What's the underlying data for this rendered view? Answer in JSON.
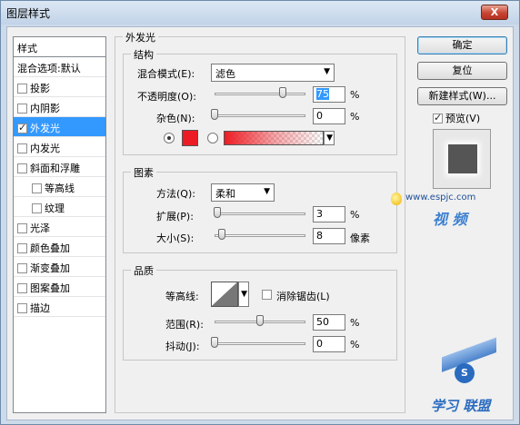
{
  "window": {
    "title": "图层样式",
    "close": "X"
  },
  "styles_list": {
    "header": "样式",
    "items": [
      {
        "label": "混合选项:默认",
        "checkbox": false,
        "checked": false,
        "selected": false,
        "indent": false
      },
      {
        "label": "投影",
        "checkbox": true,
        "checked": false,
        "selected": false,
        "indent": false
      },
      {
        "label": "内阴影",
        "checkbox": true,
        "checked": false,
        "selected": false,
        "indent": false
      },
      {
        "label": "外发光",
        "checkbox": true,
        "checked": true,
        "selected": true,
        "indent": false
      },
      {
        "label": "内发光",
        "checkbox": true,
        "checked": false,
        "selected": false,
        "indent": false
      },
      {
        "label": "斜面和浮雕",
        "checkbox": true,
        "checked": false,
        "selected": false,
        "indent": false
      },
      {
        "label": "等高线",
        "checkbox": true,
        "checked": false,
        "selected": false,
        "indent": true
      },
      {
        "label": "纹理",
        "checkbox": true,
        "checked": false,
        "selected": false,
        "indent": true
      },
      {
        "label": "光泽",
        "checkbox": true,
        "checked": false,
        "selected": false,
        "indent": false
      },
      {
        "label": "颜色叠加",
        "checkbox": true,
        "checked": false,
        "selected": false,
        "indent": false
      },
      {
        "label": "渐变叠加",
        "checkbox": true,
        "checked": false,
        "selected": false,
        "indent": false
      },
      {
        "label": "图案叠加",
        "checkbox": true,
        "checked": false,
        "selected": false,
        "indent": false
      },
      {
        "label": "描边",
        "checkbox": true,
        "checked": false,
        "selected": false,
        "indent": false
      }
    ]
  },
  "outer_glow": {
    "title": "外发光",
    "structure": {
      "title": "结构",
      "blend_mode_label": "混合模式(E):",
      "blend_mode_value": "滤色",
      "opacity_label": "不透明度(O):",
      "opacity_value": "75",
      "opacity_level": 0.75,
      "noise_label": "杂色(N):",
      "noise_value": "0",
      "noise_level": 0,
      "unit_percent": "%",
      "glow_color": "#ed1c24"
    },
    "elements": {
      "title": "图素",
      "technique_label": "方法(Q):",
      "technique_value": "柔和",
      "spread_label": "扩展(P):",
      "spread_value": "3",
      "spread_level": 0.03,
      "size_label": "大小(S):",
      "size_value": "8",
      "size_level": 0.08,
      "unit_percent": "%",
      "unit_pixel": "像素"
    },
    "quality": {
      "title": "品质",
      "contour_label": "等高线:",
      "antialias_label": "消除锯齿(L)",
      "antialias_checked": false,
      "range_label": "范围(R):",
      "range_value": "50",
      "range_level": 0.5,
      "jitter_label": "抖动(J):",
      "jitter_value": "0",
      "jitter_level": 0,
      "unit_percent": "%"
    }
  },
  "buttons": {
    "ok": "确定",
    "reset": "复位",
    "new_style": "新建样式(W)...",
    "preview_label": "预览(V)",
    "preview_checked": true
  },
  "watermarks": {
    "site": "www.espjc.com",
    "brand1": "视 频",
    "brand2": "学习 联盟"
  },
  "colors": {
    "selection": "#3399ff",
    "glow": "#ed1c24"
  }
}
